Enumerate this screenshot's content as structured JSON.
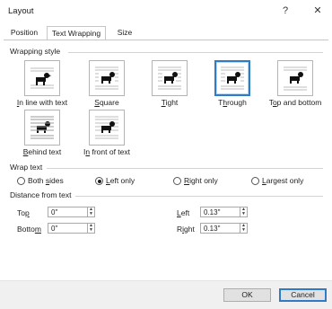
{
  "window": {
    "title": "Layout",
    "help": "?",
    "close": "✕"
  },
  "tabs": [
    {
      "label": "Position"
    },
    {
      "label": "Text Wrapping"
    },
    {
      "label": "Size"
    }
  ],
  "wrapping_style": {
    "heading": "Wrapping style",
    "selected": "Through",
    "options": [
      {
        "pre": "",
        "u": "I",
        "post": "n line with text"
      },
      {
        "pre": "",
        "u": "S",
        "post": "quare"
      },
      {
        "pre": "",
        "u": "T",
        "post": "ight"
      },
      {
        "pre": "T",
        "u": "h",
        "post": "rough"
      },
      {
        "pre": "T",
        "u": "o",
        "post": "p and bottom"
      },
      {
        "pre": "",
        "u": "B",
        "post": "ehind text"
      },
      {
        "pre": "I",
        "u": "n",
        "post": " front of text"
      }
    ]
  },
  "wrap_text": {
    "heading": "Wrap text",
    "selected": "Left only",
    "options": [
      {
        "pre": "Both ",
        "u": "s",
        "post": "ides"
      },
      {
        "pre": "",
        "u": "L",
        "post": "eft only"
      },
      {
        "pre": "",
        "u": "R",
        "post": "ight only"
      },
      {
        "pre": "",
        "u": "L",
        "post": "argest only"
      }
    ]
  },
  "distance": {
    "heading": "Distance from text",
    "top": {
      "pre": "To",
      "u": "p",
      "post": "",
      "value": "0\""
    },
    "bottom": {
      "pre": "Botto",
      "u": "m",
      "post": "",
      "value": "0\""
    },
    "left": {
      "pre": "",
      "u": "L",
      "post": "eft",
      "value": "0.13\""
    },
    "right": {
      "pre": "R",
      "u": "i",
      "post": "ght",
      "value": "0.13\""
    }
  },
  "footer": {
    "ok": "OK",
    "cancel": "Cancel"
  }
}
